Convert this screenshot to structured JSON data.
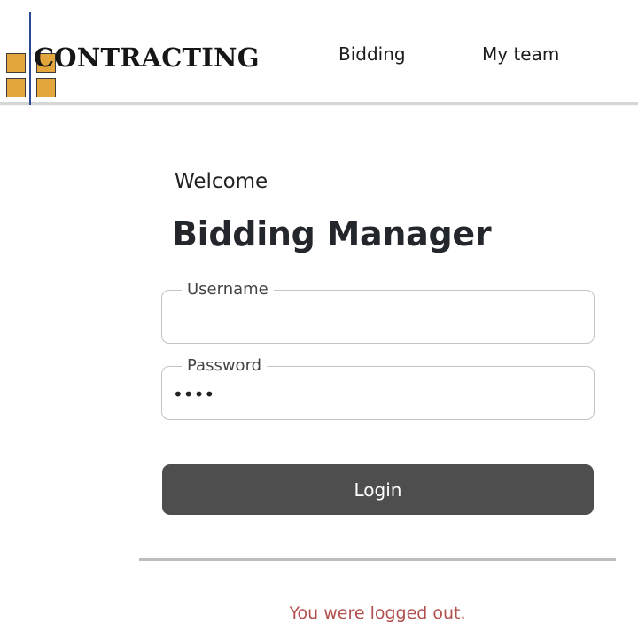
{
  "header": {
    "logo_text": "CONTRACTING",
    "nav": [
      {
        "label": "Bidding"
      },
      {
        "label": "My team"
      }
    ]
  },
  "login": {
    "welcome": "Welcome",
    "title": "Bidding Manager",
    "username": {
      "label": "Username",
      "value": ""
    },
    "password": {
      "label": "Password",
      "value": "••••"
    },
    "submit_label": "Login"
  },
  "status": {
    "message": "You were logged out."
  },
  "colors": {
    "logo_squares": "#e3a63c",
    "logo_line": "#2b4a93",
    "button_bg": "#4e4e4e",
    "status_text": "#b2504f"
  }
}
